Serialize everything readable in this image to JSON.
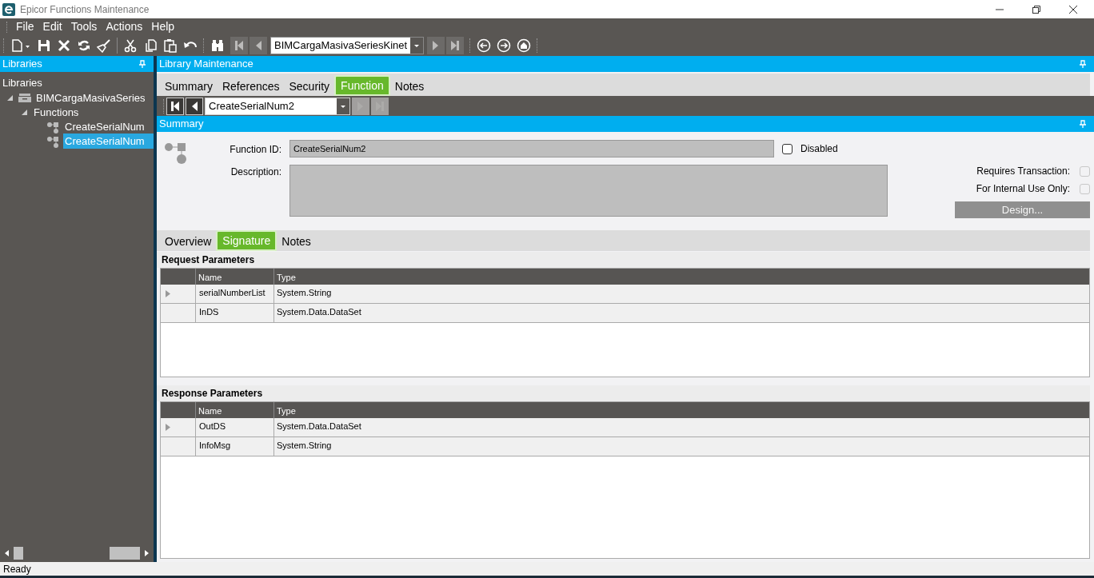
{
  "window": {
    "title": "Epicor Functions Maintenance"
  },
  "menu": [
    "File",
    "Edit",
    "Tools",
    "Actions",
    "Help"
  ],
  "toolbar": {
    "record_combo": "BIMCargaMasivaSeriesKinet"
  },
  "libraries_panel": {
    "title": "Libraries",
    "root_label": "Libraries",
    "tree": [
      {
        "label": "BIMCargaMasivaSeries",
        "kind": "library",
        "expanded": true,
        "selected": false,
        "children": [
          {
            "label": "Functions",
            "expanded": true,
            "selected": false,
            "children": [
              {
                "label": "CreateSerialNum",
                "kind": "function",
                "selected": false
              },
              {
                "label": "CreateSerialNum",
                "kind": "function",
                "selected": true
              }
            ]
          }
        ]
      }
    ]
  },
  "main_panel": {
    "title": "Library Maintenance",
    "tabs": [
      {
        "label": "Summary",
        "selected": false
      },
      {
        "label": "References",
        "selected": false
      },
      {
        "label": "Security",
        "selected": false
      },
      {
        "label": "Function",
        "selected": true
      },
      {
        "label": "Notes",
        "selected": false
      }
    ],
    "function_combo": "CreateSerialNum2",
    "summary": {
      "title": "Summary",
      "function_id_label": "Function ID:",
      "function_id": "CreateSerialNum2",
      "disabled": {
        "label": "Disabled",
        "checked": false
      },
      "description_label": "Description:",
      "requires_transaction": {
        "label": "Requires Transaction:",
        "checked": false
      },
      "internal_use_only": {
        "label": "For Internal Use Only:",
        "checked": false
      },
      "design_button": {
        "label": "Design...",
        "disabled": true
      }
    },
    "sub_tabs": [
      {
        "label": "Overview",
        "selected": false
      },
      {
        "label": "Signature",
        "selected": true
      },
      {
        "label": "Notes",
        "selected": false
      }
    ],
    "request_parameters": {
      "title": "Request Parameters",
      "columns": [
        "Name",
        "Type"
      ],
      "rows": [
        {
          "name": "serialNumberList",
          "type": "System.String",
          "current": true
        },
        {
          "name": "InDS",
          "type": "System.Data.DataSet",
          "current": false
        }
      ]
    },
    "response_parameters": {
      "title": "Response Parameters",
      "columns": [
        "Name",
        "Type"
      ],
      "rows": [
        {
          "name": "OutDS",
          "type": "System.Data.DataSet",
          "current": true
        },
        {
          "name": "InfoMsg",
          "type": "System.String",
          "current": false
        }
      ]
    }
  },
  "status_bar": "Ready"
}
